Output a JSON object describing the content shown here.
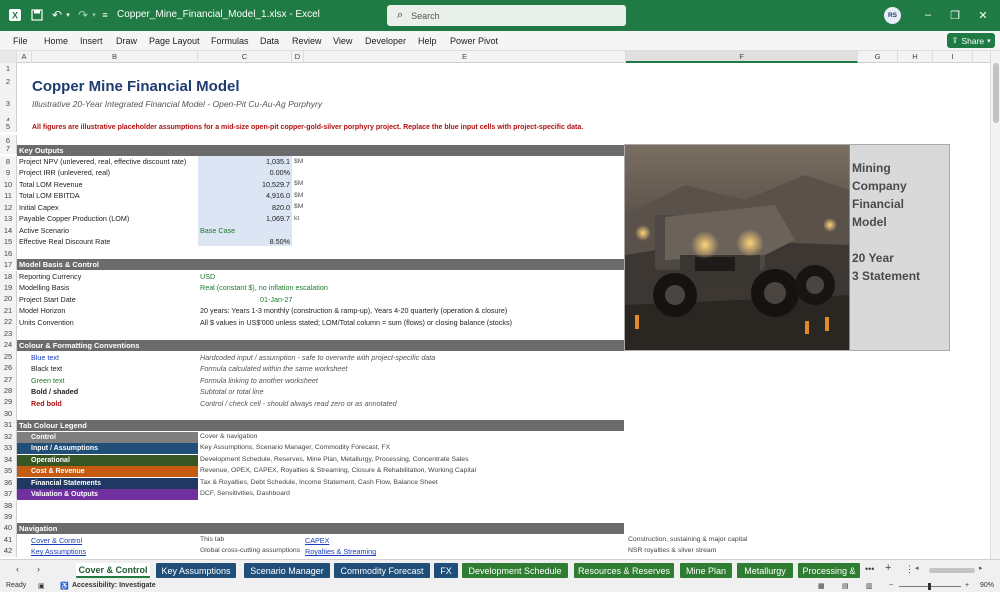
{
  "titlebar": {
    "filename": "Copper_Mine_Financial_Model_1.xlsx  -  Excel",
    "search_placeholder": "Search",
    "user_initials": "RS"
  },
  "menu": [
    "File",
    "Home",
    "Insert",
    "Draw",
    "Page Layout",
    "Formulas",
    "Data",
    "Review",
    "View",
    "Developer",
    "Help",
    "Power Pivot"
  ],
  "share_label": "Share",
  "columns": [
    "A",
    "B",
    "C",
    "D",
    "E",
    "F",
    "G",
    "H",
    "I"
  ],
  "rows": [
    "1",
    "2",
    "3",
    "4",
    "5",
    "6",
    "7",
    "8",
    "9",
    "10",
    "11",
    "12",
    "13",
    "14",
    "15",
    "16",
    "17",
    "18",
    "19",
    "20",
    "21",
    "22",
    "23",
    "24",
    "25",
    "26",
    "27",
    "28",
    "29",
    "30",
    "31",
    "32",
    "33",
    "34",
    "35",
    "36",
    "37",
    "38",
    "39",
    "40",
    "41",
    "42"
  ],
  "sheet": {
    "title": "Copper Mine Financial Model",
    "subtitle": "Illustrative 20-Year Integrated Financial Model - Open-Pit Cu-Au-Ag Porphyry",
    "warning": "All figures are illustrative placeholder assumptions for a mid-size open-pit copper-gold-silver porphyry project. Replace the blue input cells with project-specific data.",
    "key_outputs": {
      "header": "Key Outputs",
      "rows": [
        {
          "label": "Project NPV (unlevered, real, effective discount rate)",
          "value": "1,035.1",
          "unit": "$M"
        },
        {
          "label": "Project IRR (unlevered, real)",
          "value": "0.00%",
          "unit": ""
        },
        {
          "label": "Total LOM Revenue",
          "value": "10,529.7",
          "unit": "$M"
        },
        {
          "label": "Total LOM EBITDA",
          "value": "4,916.0",
          "unit": "$M"
        },
        {
          "label": "Initial Capex",
          "value": "820.0",
          "unit": "$M"
        },
        {
          "label": "Payable Copper Production (LOM)",
          "value": "1,069.7",
          "unit": "kt"
        },
        {
          "label": "Active Scenario",
          "value": "Base Case",
          "unit": ""
        },
        {
          "label": "Effective Real Discount Rate",
          "value": "8.50%",
          "unit": ""
        }
      ]
    },
    "model_basis": {
      "header": "Model Basis & Control",
      "rows": [
        {
          "label": "Reporting Currency",
          "value": "USD"
        },
        {
          "label": "Modelling Basis",
          "value": "Real (constant $), no inflation escalation"
        },
        {
          "label": "Project Start Date",
          "value": "01-Jan-27"
        },
        {
          "label": "Model Horizon",
          "value": "20 years: Years 1-3 monthly (construction & ramp-up), Years 4-20 quarterly (operation & closure)"
        },
        {
          "label": "Units Convention",
          "value": "All $ values in US$'000 unless stated; LOM/Total column = sum (flows) or closing balance (stocks)"
        }
      ]
    },
    "conventions": {
      "header": "Colour & Formatting Conventions",
      "rows": [
        {
          "label": "Blue text",
          "desc": "Hardcoded input / assumption - safe to overwrite with project-specific data"
        },
        {
          "label": "Black text",
          "desc": "Formula calculated within the same worksheet"
        },
        {
          "label": "Green text",
          "desc": "Formula linking to another worksheet"
        },
        {
          "label": "Bold / shaded",
          "desc": "Subtotal or total line"
        },
        {
          "label": "Red bold",
          "desc": "Control / check cell - should always read zero or as annotated"
        }
      ]
    },
    "legend": {
      "header": "Tab Colour Legend",
      "rows": [
        {
          "label": "Control",
          "desc": "Cover & navigation",
          "color": "#7f7f7f"
        },
        {
          "label": "Input / Assumptions",
          "desc": "Key Assumptions, Scenario Manager, Commodity Forecast, FX",
          "color": "#1f4e79"
        },
        {
          "label": "Operational",
          "desc": "Development Schedule, Reserves, Mine Plan, Metallurgy, Processing, Concentrate Sales",
          "color": "#375623"
        },
        {
          "label": "Cost & Revenue",
          "desc": "Revenue, OPEX, CAPEX, Royalties & Streaming, Closure & Rehabilitation, Working Capital",
          "color": "#c55a11"
        },
        {
          "label": "Financial Statements",
          "desc": "Tax & Royalties, Debt Schedule, Income Statement, Cash Flow, Balance Sheet",
          "color": "#203864"
        },
        {
          "label": "Valuation & Outputs",
          "desc": "DCF, Sensitivities, Dashboard",
          "color": "#7030a0"
        }
      ]
    },
    "navigation": {
      "header": "Navigation",
      "rows": [
        {
          "link1": "Cover & Control",
          "desc1": "This tab",
          "link2": "CAPEX",
          "desc2": "Construction, sustaining & major capital"
        },
        {
          "link1": "Key Assumptions",
          "desc1": "Global cross-cutting assumptions",
          "link2": "Royalties & Streaming",
          "desc2": "NSR royalties & silver stream"
        }
      ]
    },
    "picture_caption": [
      "Mining",
      "Company",
      "Financial",
      "Model",
      "",
      "20 Year",
      "3 Statement"
    ]
  },
  "tabs": [
    {
      "label": "Cover & Control",
      "color": "#ffffff",
      "active": true
    },
    {
      "label": "Key Assumptions",
      "color": "#1f4e79"
    },
    {
      "label": "Scenario Manager",
      "color": "#1f4e79"
    },
    {
      "label": "Commodity Forecast",
      "color": "#1f4e79"
    },
    {
      "label": "FX",
      "color": "#1f4e79"
    },
    {
      "label": "Development Schedule",
      "color": "#2e7d32"
    },
    {
      "label": "Resources & Reserves",
      "color": "#2e7d32"
    },
    {
      "label": "Mine Plan",
      "color": "#2e7d32"
    },
    {
      "label": "Metallurgy",
      "color": "#2e7d32"
    },
    {
      "label": "Processing &",
      "color": "#2e7d32"
    }
  ],
  "status": {
    "ready": "Ready",
    "accessibility": "Accessibility: Investigate",
    "zoom": "90%"
  },
  "colors": {
    "titlebar": "#1f7a43",
    "band": "#6b6b6b",
    "input_fill": "#dbe5f3"
  }
}
